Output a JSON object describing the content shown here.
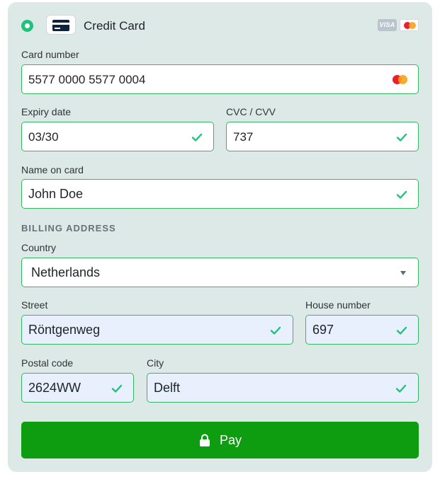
{
  "payment_method": {
    "label": "Credit Card",
    "selected": true,
    "brands": [
      "VISA",
      "mastercard"
    ],
    "visa_text": "VISA"
  },
  "fields": {
    "card_number": {
      "label": "Card number",
      "value": "5577 0000 5577 0004",
      "brand_icon": "mastercard-icon"
    },
    "expiry_date": {
      "label": "Expiry date",
      "value": "03/30"
    },
    "cvc": {
      "label": "CVC / CVV",
      "value": "737"
    },
    "name_on_card": {
      "label": "Name on card",
      "value": "John Doe"
    }
  },
  "billing": {
    "title": "BILLING ADDRESS",
    "country": {
      "label": "Country",
      "value": "Netherlands"
    },
    "street": {
      "label": "Street",
      "value": "Röntgenweg"
    },
    "house_number": {
      "label": "House number",
      "value": "697"
    },
    "postal_code": {
      "label": "Postal code",
      "value": "2624WW"
    },
    "city": {
      "label": "City",
      "value": "Delft"
    }
  },
  "pay_button": {
    "label": "Pay",
    "icon": "lock-icon"
  },
  "colors": {
    "panel_bg": "#dde9e6",
    "valid_border": "#34b864",
    "check": "#1fc27a",
    "pay_bg": "#0e9c10",
    "autofill_bg": "#e8f0fe"
  }
}
